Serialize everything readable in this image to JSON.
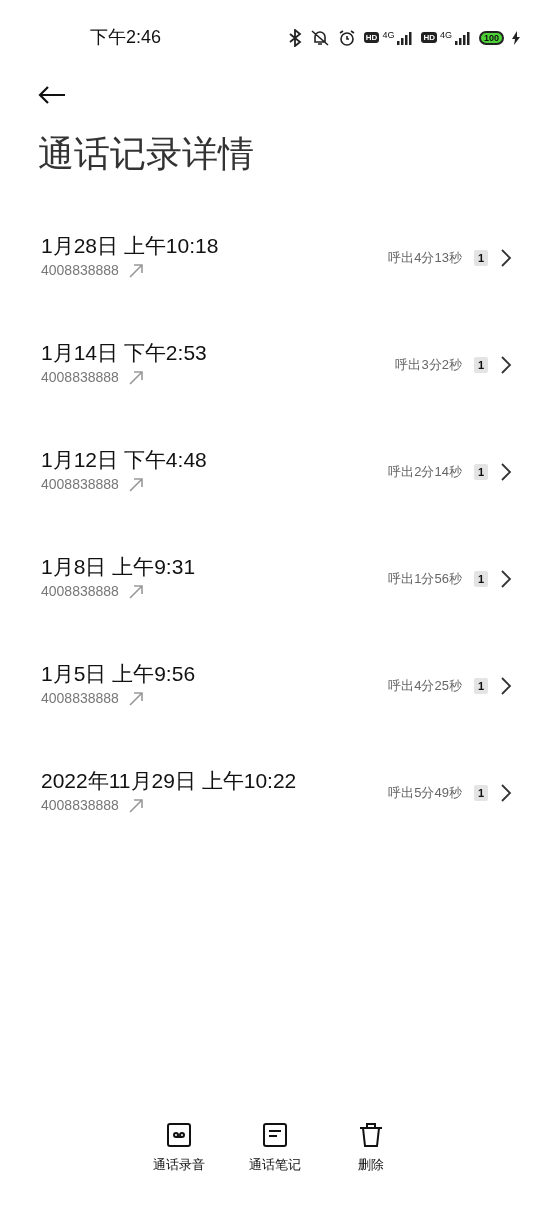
{
  "status_bar": {
    "time": "下午2:46",
    "sim_1": {
      "hd": "HD",
      "network": "4G"
    },
    "sim_2": {
      "hd": "HD",
      "network": "4G"
    },
    "battery": "100"
  },
  "title": "通话记录详情",
  "calls": [
    {
      "date": "1月28日 上午10:18",
      "number": "4008838888",
      "kind": "outgoing",
      "duration": "呼出4分13秒",
      "sim": "1"
    },
    {
      "date": "1月14日 下午2:53",
      "number": "4008838888",
      "kind": "outgoing",
      "duration": "呼出3分2秒",
      "sim": "1"
    },
    {
      "date": "1月12日 下午4:48",
      "number": "4008838888",
      "kind": "outgoing",
      "duration": "呼出2分14秒",
      "sim": "1"
    },
    {
      "date": "1月8日 上午9:31",
      "number": "4008838888",
      "kind": "outgoing",
      "duration": "呼出1分56秒",
      "sim": "1"
    },
    {
      "date": "1月5日 上午9:56",
      "number": "4008838888",
      "kind": "outgoing",
      "duration": "呼出4分25秒",
      "sim": "1"
    },
    {
      "date": "2022年11月29日 上午10:22",
      "number": "4008838888",
      "kind": "outgoing",
      "duration": "呼出5分49秒",
      "sim": "1"
    }
  ],
  "actions": [
    {
      "kind": "recording",
      "label": "通话录音"
    },
    {
      "kind": "notes",
      "label": "通话笔记"
    },
    {
      "kind": "delete",
      "label": "删除"
    }
  ]
}
